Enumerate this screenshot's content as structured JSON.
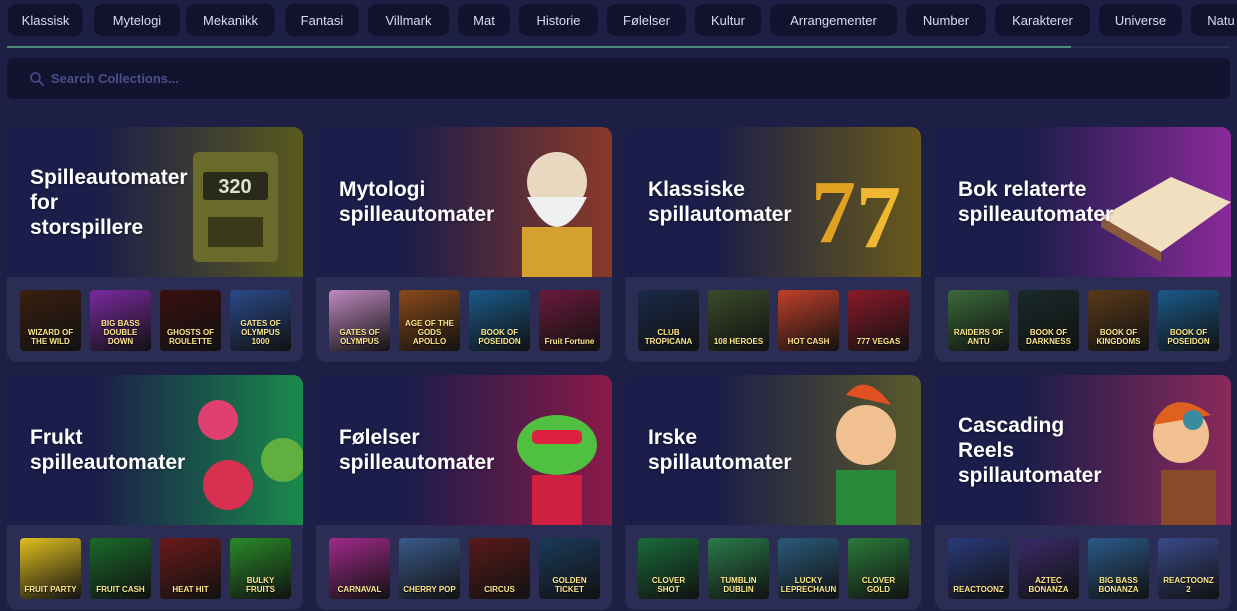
{
  "tabs": [
    "Klassisk",
    "Mytelogi",
    "Mekanikk",
    "Fantasi",
    "Villmark",
    "Mat",
    "Historie",
    "Følelser",
    "Kultur",
    "Arrangementer",
    "Number",
    "Karakterer",
    "Universe",
    "Natu"
  ],
  "scroll_progress": 0.87,
  "search": {
    "placeholder": "Search Collections..."
  },
  "collections": [
    {
      "title_lines": [
        "Spilleautomater",
        "for",
        "storspillere"
      ],
      "gradient": [
        "#1b1d4a",
        "#5a5a1e"
      ],
      "art_icon": "slot-machine-icon",
      "games": [
        {
          "label": "WIZARD OF THE WILD",
          "color": "#3a1f10"
        },
        {
          "label": "BIG BASS DOUBLE DOWN",
          "color": "#7a2aa0"
        },
        {
          "label": "GHOSTS OF ROULETTE",
          "color": "#3a1010"
        },
        {
          "label": "GATES OF OLYMPUS 1000",
          "color": "#2a4a8a"
        }
      ]
    },
    {
      "title_lines": [
        "Mytologi",
        "spilleautomater"
      ],
      "gradient": [
        "#1b1d4a",
        "#8a3a2a"
      ],
      "art_icon": "zeus-icon",
      "games": [
        {
          "label": "GATES OF OLYMPUS",
          "color": "#c08ac0"
        },
        {
          "label": "AGE OF THE GODS APOLLO",
          "color": "#8a4a1a"
        },
        {
          "label": "BOOK OF POSEIDON",
          "color": "#1a5a8a"
        },
        {
          "label": "Fruit Fortune",
          "color": "#6a1a3a"
        }
      ]
    },
    {
      "title_lines": [
        "Klassiske",
        "spillautomater"
      ],
      "gradient": [
        "#1b1d4a",
        "#6a5a1a"
      ],
      "art_icon": "lucky-seven-icon",
      "games": [
        {
          "label": "CLUB TROPICANA",
          "color": "#1a2a4a"
        },
        {
          "label": "108 HEROES",
          "color": "#3a4a2a"
        },
        {
          "label": "HOT CASH",
          "color": "#c0402a"
        },
        {
          "label": "777 VEGAS",
          "color": "#8a1a2a"
        }
      ]
    },
    {
      "title_lines": [
        "Bok relaterte",
        "spilleautomater"
      ],
      "gradient": [
        "#1b1d4a",
        "#8a2a9a"
      ],
      "art_icon": "book-icon",
      "games": [
        {
          "label": "RAIDERS OF ANTU",
          "color": "#3a6a3a"
        },
        {
          "label": "BOOK OF DARKNESS",
          "color": "#1a2a2a"
        },
        {
          "label": "BOOK OF KINGDOMS",
          "color": "#5a3a1a"
        },
        {
          "label": "BOOK OF POSEIDON",
          "color": "#1a5a8a"
        }
      ]
    },
    {
      "title_lines": [
        "Frukt",
        "spilleautomater"
      ],
      "gradient": [
        "#1b1d4a",
        "#1a8a4a"
      ],
      "art_icon": "dragon-fruit-icon",
      "games": [
        {
          "label": "FRUIT PARTY",
          "color": "#e0c020"
        },
        {
          "label": "FRUIT CASH",
          "color": "#1a6a2a"
        },
        {
          "label": "HEAT HIT",
          "color": "#6a1a1a"
        },
        {
          "label": "BULKY FRUITS",
          "color": "#2a8a2a"
        }
      ]
    },
    {
      "title_lines": [
        "Følelser",
        "spilleautomater"
      ],
      "gradient": [
        "#1b1d4a",
        "#8a1a4a"
      ],
      "art_icon": "frog-guitar-icon",
      "games": [
        {
          "label": "CARNAVAL",
          "color": "#a02a8a"
        },
        {
          "label": "CHERRY POP",
          "color": "#3a5a8a"
        },
        {
          "label": "CIRCUS",
          "color": "#5a1a1a"
        },
        {
          "label": "GOLDEN TICKET",
          "color": "#1a3a5a"
        }
      ]
    },
    {
      "title_lines": [
        "Irske",
        "spillautomater"
      ],
      "gradient": [
        "#1b1d4a",
        "#5a5a2a"
      ],
      "art_icon": "leprechaun-icon",
      "games": [
        {
          "label": "CLOVER SHOT",
          "color": "#1a6a3a"
        },
        {
          "label": "TUMBLIN DUBLIN",
          "color": "#2a7a4a"
        },
        {
          "label": "LUCKY LEPRECHAUN",
          "color": "#2a5a7a"
        },
        {
          "label": "CLOVER GOLD",
          "color": "#2a7a3a"
        }
      ]
    },
    {
      "title_lines": [
        "Cascading",
        "Reels",
        "spillautomater"
      ],
      "gradient": [
        "#1b1d4a",
        "#8a2a5a"
      ],
      "art_icon": "mad-scientist-icon",
      "games": [
        {
          "label": "REACTOONZ",
          "color": "#2a3a7a"
        },
        {
          "label": "AZTEC BONANZA",
          "color": "#3a2a6a"
        },
        {
          "label": "BIG BASS BONANZA",
          "color": "#2a5a8a"
        },
        {
          "label": "REACTOONZ 2",
          "color": "#3a4a8a"
        }
      ]
    }
  ]
}
